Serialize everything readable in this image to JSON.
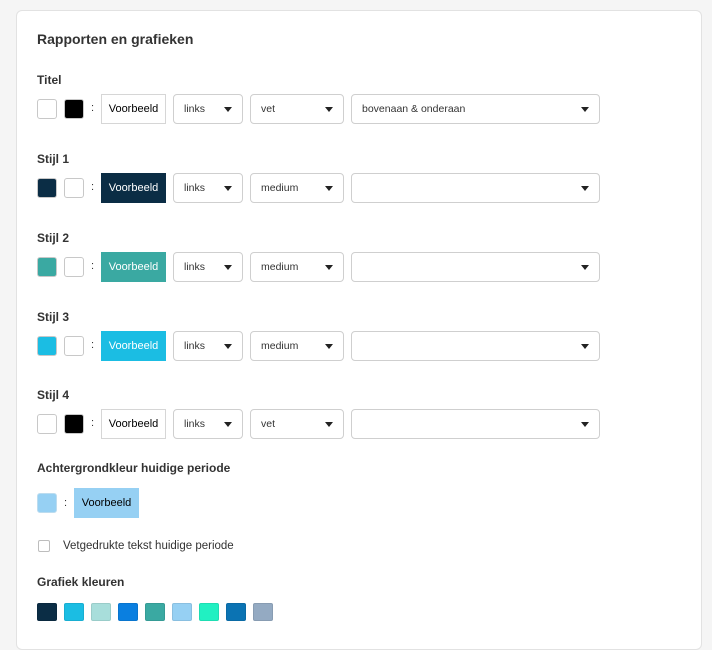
{
  "title": "Rapporten en grafieken",
  "rows": [
    {
      "label": "Titel",
      "bg": "#ffffff",
      "fg": "#000000",
      "preview_text": "Voorbeeld",
      "preview_bg": "#ffffff",
      "preview_color": "#000000",
      "align": "links",
      "weight": "vet",
      "border": "bovenaan & onderaan"
    },
    {
      "label": "Stijl 1",
      "bg": "#0b2d45",
      "fg": "#ffffff",
      "preview_text": "Voorbeeld",
      "preview_bg": "#0b2d45",
      "preview_color": "#ffffff",
      "align": "links",
      "weight": "medium",
      "border": ""
    },
    {
      "label": "Stijl 2",
      "bg": "#3aa9a2",
      "fg": "#ffffff",
      "preview_text": "Voorbeeld",
      "preview_bg": "#3aa9a2",
      "preview_color": "#ffffff",
      "align": "links",
      "weight": "medium",
      "border": ""
    },
    {
      "label": "Stijl 3",
      "bg": "#1bbde3",
      "fg": "#ffffff",
      "preview_text": "Voorbeeld",
      "preview_bg": "#1bbde3",
      "preview_color": "#ffffff",
      "align": "links",
      "weight": "medium",
      "border": ""
    },
    {
      "label": "Stijl 4",
      "bg": "#ffffff",
      "fg": "#000000",
      "preview_text": "Voorbeeld",
      "preview_bg": "#ffffff",
      "preview_color": "#000000",
      "align": "links",
      "weight": "vet",
      "border": ""
    }
  ],
  "background": {
    "label": "Achtergrondkleur huidige periode",
    "color": "#96d0f3",
    "preview_text": "Voorbeeld"
  },
  "bold_checkbox": {
    "label": "Vetgedrukte tekst huidige periode",
    "checked": false
  },
  "chart_colors": {
    "label": "Grafiek kleuren",
    "colors": [
      "#0b2d45",
      "#1bbde3",
      "#a8dedb",
      "#0a7fe0",
      "#3aa9a2",
      "#96d0f3",
      "#21f0c2",
      "#0b73b3",
      "#94aac2"
    ]
  }
}
